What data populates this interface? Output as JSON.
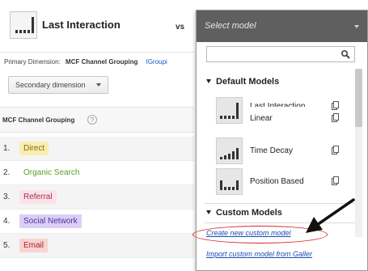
{
  "header": {
    "model_name": "Last Interaction",
    "vs_label": "vs"
  },
  "primary_dimension": {
    "label": "Primary Dimension:",
    "value": "MCF Channel Grouping",
    "link": "IGroupi"
  },
  "secondary_dimension": {
    "label": "Secondary dimension"
  },
  "table": {
    "column_header": "MCF Channel Grouping",
    "help_icon": "?",
    "rows": [
      {
        "index": "1.",
        "label": "Direct",
        "bg": "#f9edb5",
        "fg": "#8a6d00"
      },
      {
        "index": "2.",
        "label": "Organic Search",
        "bg": "#ffffff",
        "fg": "#5aa02c"
      },
      {
        "index": "3.",
        "label": "Referral",
        "bg": "#fbe3ea",
        "fg": "#a03050"
      },
      {
        "index": "4.",
        "label": "Social Network",
        "bg": "#dccff6",
        "fg": "#5030a0"
      },
      {
        "index": "5.",
        "label": "Email",
        "bg": "#f8d3d3",
        "fg": "#b02020"
      }
    ]
  },
  "dropdown": {
    "title": "Select model",
    "search": {
      "value": "",
      "placeholder": ""
    },
    "default_heading": "Default Models",
    "default_models": [
      {
        "name_overlap": "Last Interaction",
        "name": "Linear",
        "icon": "linear-model-icon"
      },
      {
        "name": "Time Decay",
        "icon": "time-decay-model-icon"
      },
      {
        "name": "Position Based",
        "icon": "position-based-model-icon"
      }
    ],
    "custom_heading": "Custom Models",
    "create_link": "Create new custom model",
    "import_link": "Import custom model from Galler"
  },
  "colors": {
    "dropdown_header": "#5f5f5f",
    "link": "#1a4db3",
    "annotation": "#d8262a"
  }
}
